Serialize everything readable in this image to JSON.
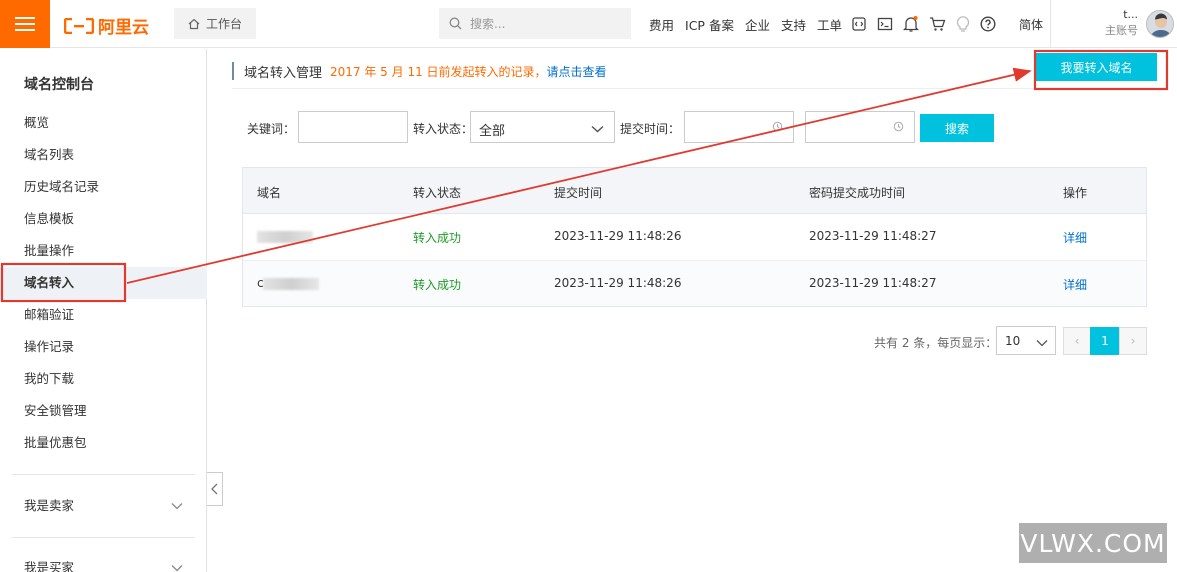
{
  "header": {
    "logo_text": "阿里云",
    "workbench_label": "工作台",
    "search_placeholder": "搜索...",
    "nav_links": [
      "费用",
      "ICP 备案",
      "企业",
      "支持",
      "工单"
    ],
    "language": "简体",
    "account_name": "t...",
    "account_type": "主账号",
    "brand_color": "#ff6a00"
  },
  "sidebar": {
    "title": "域名控制台",
    "items": [
      "概览",
      "域名列表",
      "历史域名记录",
      "信息模板",
      "批量操作",
      "域名转入",
      "邮箱验证",
      "操作记录",
      "我的下载",
      "安全锁管理",
      "批量优惠包"
    ],
    "active_index": 5,
    "groups": [
      "我是卖家",
      "我是买家"
    ]
  },
  "page": {
    "title": "域名转入管理",
    "notice": "2017 年 5 月 11 日前发起转入的记录，",
    "notice_link": "请点击查看",
    "primary_button": "我要转入域名",
    "accent_color": "#00c1de"
  },
  "filters": {
    "keyword_label": "关键词：",
    "keyword_value": "",
    "status_label": "转入状态：",
    "status_value": "全部",
    "time_label": "提交时间：",
    "search_button": "搜索"
  },
  "table": {
    "columns": [
      "域名",
      "转入状态",
      "提交时间",
      "密码提交成功时间",
      "操作"
    ],
    "rows": [
      {
        "domain": "",
        "status": "转入成功",
        "submitted": "2023-11-29 11:48:26",
        "password_ok": "2023-11-29 11:48:27",
        "action": "详细"
      },
      {
        "domain": "c",
        "status": "转入成功",
        "submitted": "2023-11-29 11:48:26",
        "password_ok": "2023-11-29 11:48:27",
        "action": "详细"
      }
    ]
  },
  "pagination": {
    "summary": "共有 2 条，每页显示：",
    "page_size": "10",
    "current_page": "1",
    "prev": "‹",
    "next": "›"
  },
  "watermark": "VLWX.COM",
  "annotation_color": "#e03a2f"
}
